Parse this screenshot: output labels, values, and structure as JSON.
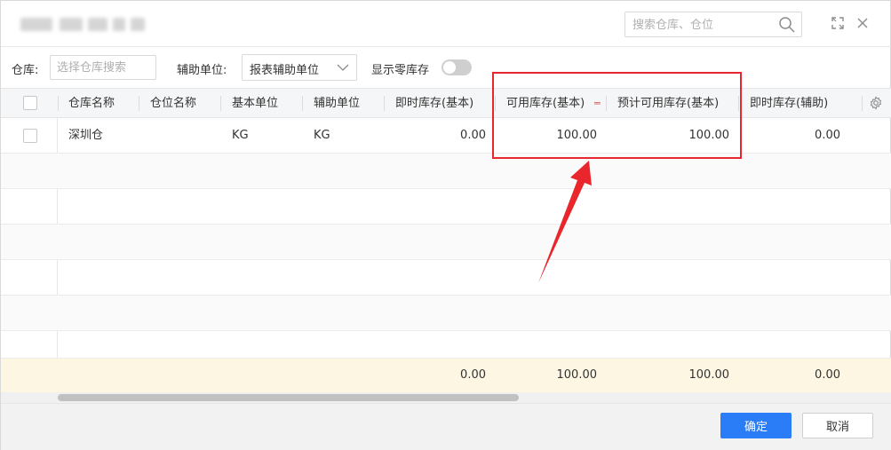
{
  "header": {
    "search_placeholder": "搜索仓库、仓位",
    "icons": [
      "search-icon",
      "expand-icon",
      "close-icon"
    ]
  },
  "filters": {
    "warehouse_label": "仓库:",
    "warehouse_placeholder": "选择仓库搜索",
    "aux_unit_label": "辅助单位:",
    "aux_unit_value": "报表辅助单位",
    "zero_stock_label": "显示零库存",
    "zero_stock_on": false
  },
  "table": {
    "columns": [
      "仓库名称",
      "仓位名称",
      "基本单位",
      "辅助单位",
      "即时库存(基本)",
      "可用库存(基本)",
      "预计可用库存(基本)",
      "即时库存(辅助)"
    ],
    "rows": [
      {
        "warehouse": "深圳仓",
        "location": "",
        "base_unit": "KG",
        "aux_unit": "KG",
        "instant_base": "0.00",
        "available_base": "100.00",
        "expected_available_base": "100.00",
        "instant_aux": "0.00"
      }
    ],
    "totals": {
      "instant_base": "0.00",
      "available_base": "100.00",
      "expected_available_base": "100.00",
      "instant_aux": "0.00"
    }
  },
  "footer": {
    "confirm_label": "确定",
    "cancel_label": "取消"
  },
  "colors": {
    "primary": "#2a7cf7",
    "annotation": "#e8262b",
    "total_row_bg": "#fdf6e3"
  }
}
